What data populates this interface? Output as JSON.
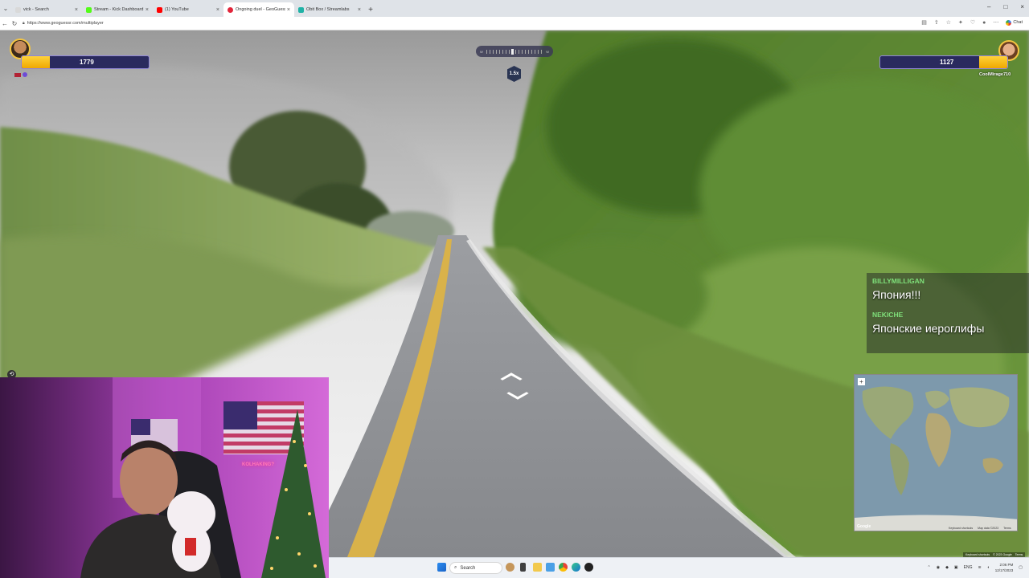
{
  "browser": {
    "tabs": [
      {
        "label": "vick - Search",
        "color": "#d9d9d9"
      },
      {
        "label": "Stream - Kick Dashboard",
        "color": "#53fc18"
      },
      {
        "label": "(1) YouTube",
        "color": "#ff0000"
      },
      {
        "label": "Ongoing duel - GeoGuessr",
        "color": "#e2253a"
      },
      {
        "label": "Obit Box / Streamlabs",
        "color": "#1fb2a6"
      }
    ],
    "tab_close": "×",
    "new_tab": "+",
    "url": "https://www.geoguessr.com/multiplayer",
    "chat_button": "Chat",
    "window_controls": [
      "–",
      "□",
      "×"
    ]
  },
  "hud": {
    "left_player": {
      "score": "1779",
      "health_fraction": 0.22
    },
    "right_player": {
      "score": "1127",
      "name": "CoolMirage710",
      "health_fraction": 0.22
    },
    "round_multiplier": "1.5x",
    "compass": {
      "left": "W",
      "right": "W"
    }
  },
  "chat": [
    {
      "user": "BILLYMILLIGAN",
      "message": "Япония!!!"
    },
    {
      "user": "NEKICHE",
      "message": "Японские иероглифы"
    }
  ],
  "minimap": {
    "zoom_in": "+",
    "google": "Google",
    "footer": [
      "Keyboard shortcuts",
      "Map data ©2023",
      "Terms"
    ]
  },
  "attribution": [
    "Keyboard shortcuts",
    "© 2023 Google",
    "Terms"
  ],
  "webcam": {
    "neon_sign": "KOLHAKING?"
  },
  "taskbar": {
    "search_placeholder": "Search",
    "language": "ENG",
    "time": "2:06 PM",
    "date": "12/17/2023"
  },
  "colors": {
    "accent_yellow": "#ffd23a",
    "hud_panel": "#2a2a5e",
    "chat_username": "#7fe07a"
  }
}
